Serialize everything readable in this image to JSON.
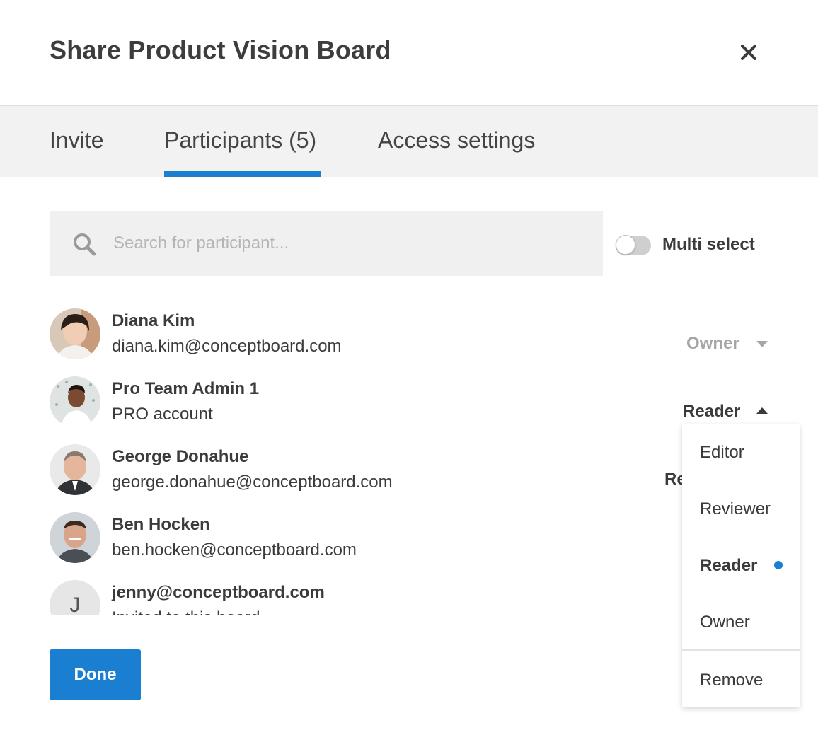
{
  "dialog": {
    "title": "Share Product Vision Board",
    "close_icon": "close-icon"
  },
  "tabs": [
    {
      "label": "Invite",
      "active": false
    },
    {
      "label": "Participants (5)",
      "active": true
    },
    {
      "label": "Access settings",
      "active": false
    }
  ],
  "search": {
    "placeholder": "Search for participant...",
    "value": "",
    "icon": "search-icon"
  },
  "multi_select": {
    "label": "Multi select",
    "enabled": false
  },
  "participants": [
    {
      "name": "Diana Kim",
      "subtitle": "diana.kim@conceptboard.com",
      "role": "Owner",
      "role_state": "disabled"
    },
    {
      "name": "Pro Team Admin 1",
      "subtitle": "PRO account",
      "role": "Reader",
      "role_state": "open"
    },
    {
      "name": "George Donahue",
      "subtitle": "george.donahue@conceptboard.com",
      "role": "Re",
      "role_state": "obscured"
    },
    {
      "name": "Ben Hocken",
      "subtitle": "ben.hocken@conceptboard.com",
      "role": "",
      "role_state": "obscured"
    },
    {
      "name": "jenny@conceptboard.com",
      "subtitle": "Invited to this board",
      "avatar_letter": "J",
      "role": "",
      "role_state": "obscured"
    }
  ],
  "role_menu": {
    "items": [
      "Editor",
      "Reviewer",
      "Reader",
      "Owner"
    ],
    "selected": "Reader",
    "remove_label": "Remove"
  },
  "footer": {
    "done_label": "Done"
  },
  "colors": {
    "accent": "#1a7fd1",
    "tab_bar": "#f2f2f2",
    "muted_role": "#a6a6a6",
    "text": "#3b3b3b"
  }
}
